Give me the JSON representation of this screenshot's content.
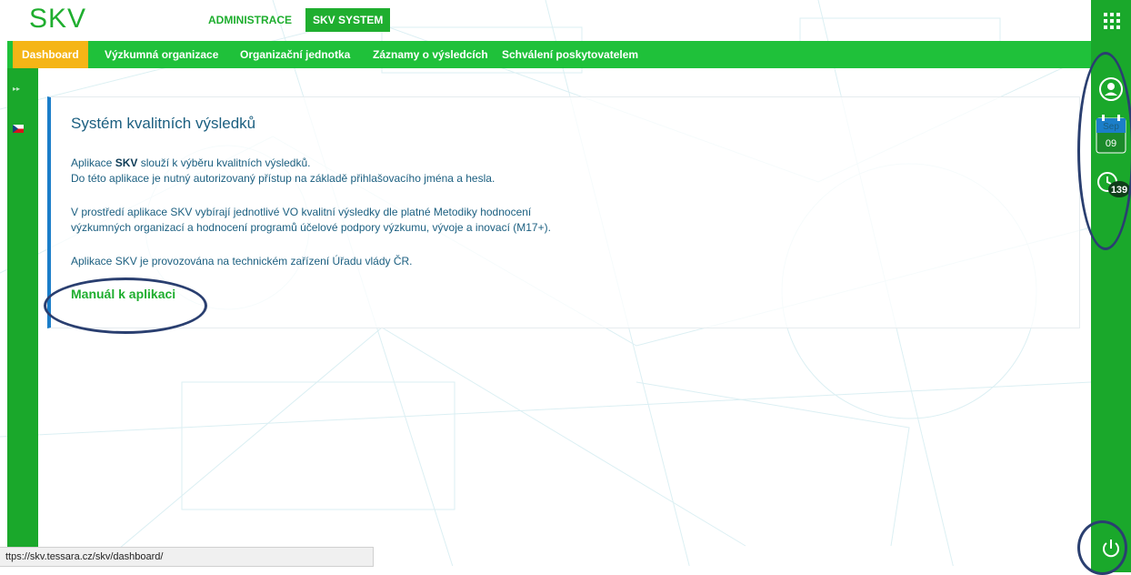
{
  "app": {
    "logo": "SKV"
  },
  "top_tabs": [
    {
      "label": "ADMINISTRACE",
      "active": false
    },
    {
      "label": "SKV SYSTEM",
      "active": true
    }
  ],
  "nav": {
    "items": [
      {
        "label": "Dashboard",
        "active": true
      },
      {
        "label": "Výzkumná organizace",
        "active": false
      },
      {
        "label": "Organizační jednotka",
        "active": false
      },
      {
        "label": "Záznamy o výsledcích",
        "active": false
      },
      {
        "label": "Schválení poskytovatelem",
        "active": false
      }
    ]
  },
  "card": {
    "title": "Systém kvalitních výsledků",
    "p1_pre": "Aplikace ",
    "p1_bold": "SKV",
    "p1_post": " slouží k výběru kvalitních výsledků.",
    "p2": "Do této aplikace je nutný autorizovaný přístup na základě přihlašovacího jména a hesla.",
    "p3": "V prostředí aplikace SKV vybírají jednotlivé VO kvalitní výsledky dle platné Metodiky hodnocení",
    "p4": "výzkumných organizací a hodnocení programů účelové podpory výzkumu, vývoje a inovací (M17+).",
    "p5": "Aplikace SKV je provozována na technickém zařízení Úřadu vlády ČR.",
    "manual_link": "Manuál k aplikaci"
  },
  "rightbar": {
    "calendar_month": "Sep",
    "calendar_day": "09",
    "notification_count": "139"
  },
  "status_bar": {
    "url": "ttps://skv.tessara.cz/skv/dashboard/"
  },
  "icons": {
    "grid": "apps-grid-icon",
    "user": "user-icon",
    "calendar": "calendar-icon",
    "notification": "clock-notification-icon",
    "power": "power-icon",
    "expand": "expand-icon",
    "flag": "czech-flag-icon"
  },
  "colors": {
    "primary_green": "#1fc13a",
    "dark_green": "#1aa82b",
    "active_tab": "#f5b516",
    "text_blue": "#1b5f80",
    "card_accent": "#1b7ec9",
    "annotation": "#2a3f70"
  }
}
